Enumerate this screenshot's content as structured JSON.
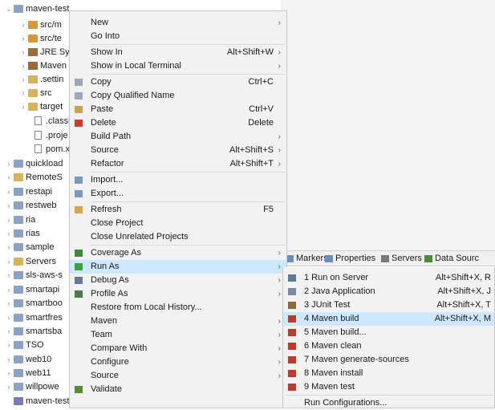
{
  "tree": [
    {
      "label": "maven-test",
      "twisty": "⌄",
      "icon": "project-icon",
      "color": "#8aa2c6",
      "cls": "ic-folder"
    },
    {
      "label": "src/m",
      "twisty": "›",
      "icon": "source-folder-icon",
      "cls": "ic-src"
    },
    {
      "label": "src/te",
      "twisty": "›",
      "icon": "source-folder-icon",
      "cls": "ic-src"
    },
    {
      "label": "JRE Sy",
      "twisty": "›",
      "icon": "library-icon",
      "cls": "ic-lib"
    },
    {
      "label": "Maven",
      "twisty": "›",
      "icon": "library-icon",
      "cls": "ic-lib"
    },
    {
      "label": ".settin",
      "twisty": "›",
      "icon": "folder-icon",
      "cls": "ic-jfolder"
    },
    {
      "label": "src",
      "twisty": "›",
      "icon": "folder-icon",
      "cls": "ic-jfolder"
    },
    {
      "label": "target",
      "twisty": "›",
      "icon": "folder-icon",
      "cls": "ic-jfolder"
    },
    {
      "label": ".classp",
      "twisty": "",
      "icon": "file-icon",
      "cls": "ic-file"
    },
    {
      "label": ".proje",
      "twisty": "",
      "icon": "file-icon",
      "cls": "ic-file"
    },
    {
      "label": "pom.x",
      "twisty": "",
      "icon": "file-icon",
      "cls": "ic-file"
    },
    {
      "label": "quickload",
      "twisty": "›",
      "icon": "project-icon",
      "cls": "ic-folder"
    },
    {
      "label": "RemoteS",
      "twisty": "›",
      "icon": "project-icon",
      "cls": "ic-jfolder"
    },
    {
      "label": "restapi",
      "twisty": "›",
      "icon": "project-icon",
      "cls": "ic-folder"
    },
    {
      "label": "restweb",
      "twisty": "›",
      "icon": "project-icon",
      "cls": "ic-folder"
    },
    {
      "label": "ria",
      "twisty": "›",
      "icon": "project-icon",
      "cls": "ic-folder"
    },
    {
      "label": "rias",
      "twisty": "›",
      "icon": "project-icon",
      "cls": "ic-folder"
    },
    {
      "label": "sample",
      "twisty": "›",
      "icon": "project-icon",
      "cls": "ic-folder"
    },
    {
      "label": "Servers",
      "twisty": "›",
      "icon": "project-icon",
      "cls": "ic-jfolder"
    },
    {
      "label": "sls-aws-s",
      "twisty": "›",
      "icon": "project-icon",
      "cls": "ic-folder"
    },
    {
      "label": "smartapi",
      "twisty": "›",
      "icon": "project-icon",
      "cls": "ic-folder"
    },
    {
      "label": "smartboo",
      "twisty": "›",
      "icon": "project-icon",
      "cls": "ic-folder"
    },
    {
      "label": "smartfres",
      "twisty": "›",
      "icon": "project-icon",
      "cls": "ic-folder"
    },
    {
      "label": "smartsba",
      "twisty": "›",
      "icon": "project-icon",
      "cls": "ic-folder"
    },
    {
      "label": "TSO",
      "twisty": "›",
      "icon": "project-icon",
      "cls": "ic-folder"
    },
    {
      "label": "web10",
      "twisty": "›",
      "icon": "project-icon",
      "cls": "ic-folder"
    },
    {
      "label": "web11",
      "twisty": "›",
      "icon": "project-icon",
      "cls": "ic-folder"
    },
    {
      "label": "willpowe",
      "twisty": "›",
      "icon": "project-icon",
      "cls": "ic-folder"
    },
    {
      "label": "maven-test",
      "twisty": "",
      "icon": "project-icon",
      "cls": "ic-mvn"
    }
  ],
  "views_bar": [
    {
      "label": "Markers",
      "icon": "markers-icon",
      "color": "#6a8fbf"
    },
    {
      "label": "Properties",
      "icon": "properties-icon",
      "color": "#6a8fbf"
    },
    {
      "label": "Servers",
      "icon": "servers-icon",
      "color": "#7a7a7a"
    },
    {
      "label": "Data Sourc",
      "icon": "data-source-icon",
      "color": "#4a8a3a"
    }
  ],
  "context_menu": [
    {
      "label": "New",
      "shortcut": "",
      "submenu": true,
      "icon": ""
    },
    {
      "label": "Go Into",
      "shortcut": "",
      "submenu": false,
      "icon": ""
    },
    {
      "sep": true
    },
    {
      "label": "Show In",
      "shortcut": "Alt+Shift+W",
      "submenu": true,
      "icon": ""
    },
    {
      "label": "Show in Local Terminal",
      "shortcut": "",
      "submenu": true,
      "icon": ""
    },
    {
      "sep": true
    },
    {
      "label": "Copy",
      "shortcut": "Ctrl+C",
      "submenu": false,
      "icon": "copy-icon",
      "color": "#9aa8b8"
    },
    {
      "label": "Copy Qualified Name",
      "shortcut": "",
      "submenu": false,
      "icon": "copy-qualified-icon",
      "color": "#9aa8b8"
    },
    {
      "label": "Paste",
      "shortcut": "Ctrl+V",
      "submenu": false,
      "icon": "paste-icon",
      "color": "#c9a44a"
    },
    {
      "label": "Delete",
      "shortcut": "Delete",
      "submenu": false,
      "icon": "delete-icon",
      "color": "#d23a2a"
    },
    {
      "label": "Build Path",
      "shortcut": "",
      "submenu": true,
      "icon": ""
    },
    {
      "label": "Source",
      "shortcut": "Alt+Shift+S",
      "submenu": true,
      "icon": ""
    },
    {
      "label": "Refactor",
      "shortcut": "Alt+Shift+T",
      "submenu": true,
      "icon": ""
    },
    {
      "sep": true
    },
    {
      "label": "Import...",
      "shortcut": "",
      "submenu": false,
      "icon": "import-icon",
      "color": "#7a9ac0"
    },
    {
      "label": "Export...",
      "shortcut": "",
      "submenu": false,
      "icon": "export-icon",
      "color": "#7a9ac0"
    },
    {
      "sep": true
    },
    {
      "label": "Refresh",
      "shortcut": "F5",
      "submenu": false,
      "icon": "refresh-icon",
      "color": "#d8a64a"
    },
    {
      "label": "Close Project",
      "shortcut": "",
      "submenu": false,
      "icon": ""
    },
    {
      "label": "Close Unrelated Projects",
      "shortcut": "",
      "submenu": false,
      "icon": ""
    },
    {
      "sep": true
    },
    {
      "label": "Coverage As",
      "shortcut": "",
      "submenu": true,
      "icon": "coverage-icon",
      "color": "#3f8a3a"
    },
    {
      "label": "Run As",
      "shortcut": "",
      "submenu": true,
      "icon": "run-icon",
      "color": "#3aa23a",
      "highlighted": true
    },
    {
      "label": "Debug As",
      "shortcut": "",
      "submenu": true,
      "icon": "debug-icon",
      "color": "#6a7a9a"
    },
    {
      "label": "Profile As",
      "shortcut": "",
      "submenu": true,
      "icon": "profile-icon",
      "color": "#4a7a4a"
    },
    {
      "label": "Restore from Local History...",
      "shortcut": "",
      "submenu": false,
      "icon": ""
    },
    {
      "label": "Maven",
      "shortcut": "",
      "submenu": true,
      "icon": ""
    },
    {
      "label": "Team",
      "shortcut": "",
      "submenu": true,
      "icon": ""
    },
    {
      "label": "Compare With",
      "shortcut": "",
      "submenu": true,
      "icon": ""
    },
    {
      "label": "Configure",
      "shortcut": "",
      "submenu": true,
      "icon": ""
    },
    {
      "label": "Source",
      "shortcut": "",
      "submenu": true,
      "icon": ""
    },
    {
      "label": "Validate",
      "shortcut": "",
      "submenu": false,
      "icon": "validate-icon",
      "color": "#5a8a3a"
    }
  ],
  "run_as_menu": [
    {
      "label": "1 Run on Server",
      "shortcut": "Alt+Shift+X, R",
      "icon": "server-run-icon",
      "color": "#5a7a9a"
    },
    {
      "label": "2 Java Application",
      "shortcut": "Alt+Shift+X, J",
      "icon": "java-app-icon",
      "color": "#7a8aa0"
    },
    {
      "label": "3 JUnit Test",
      "shortcut": "Alt+Shift+X, T",
      "icon": "junit-icon",
      "color": "#8a6a3a"
    },
    {
      "label": "4 Maven build",
      "shortcut": "Alt+Shift+X, M",
      "icon": "maven-icon",
      "color": "#c0392b",
      "highlighted": true
    },
    {
      "label": "5 Maven build...",
      "shortcut": "",
      "icon": "maven-icon",
      "color": "#c0392b"
    },
    {
      "label": "6 Maven clean",
      "shortcut": "",
      "icon": "maven-icon",
      "color": "#c0392b"
    },
    {
      "label": "7 Maven generate-sources",
      "shortcut": "",
      "icon": "maven-icon",
      "color": "#c0392b"
    },
    {
      "label": "8 Maven install",
      "shortcut": "",
      "icon": "maven-icon",
      "color": "#c0392b"
    },
    {
      "label": "9 Maven test",
      "shortcut": "",
      "icon": "maven-icon",
      "color": "#c0392b"
    },
    {
      "sep": true
    },
    {
      "label": "Run Configurations...",
      "shortcut": "",
      "icon": ""
    }
  ],
  "colors": {
    "highlight": "#cde8ff",
    "menu_bg": "#f2f2f2",
    "submenu_arrow": "›"
  }
}
